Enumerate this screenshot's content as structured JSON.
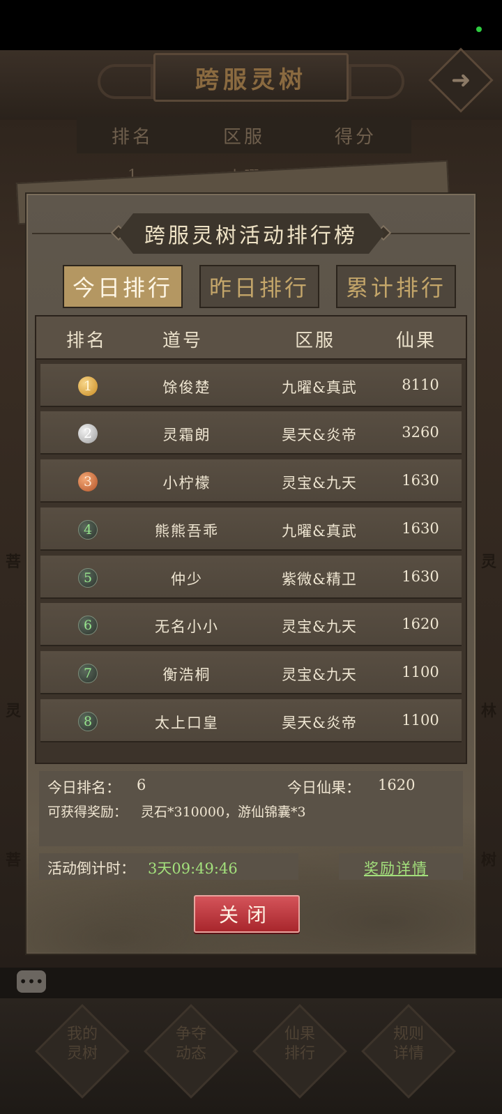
{
  "background": {
    "header_title": "跨服灵树",
    "table_headers": [
      "排名",
      "区服",
      "得分"
    ],
    "first_row": [
      "1",
      "九曜",
      ""
    ],
    "side_chars_left": [
      "菩",
      "灵",
      "菩"
    ],
    "side_chars_right": [
      "灵",
      "林",
      "树"
    ]
  },
  "modal": {
    "title": "跨服灵树活动排行榜",
    "tabs": [
      {
        "label": "今日排行",
        "active": true
      },
      {
        "label": "昨日排行",
        "active": false
      },
      {
        "label": "累计排行",
        "active": false
      }
    ],
    "columns": [
      "排名",
      "道号",
      "区服",
      "仙果"
    ],
    "rows": [
      {
        "rank": "1",
        "medal": "gold",
        "name": "馀俊楚",
        "server": "九曜&真武",
        "score": "8110"
      },
      {
        "rank": "2",
        "medal": "silver",
        "name": "灵霜朗",
        "server": "昊天&炎帝",
        "score": "3260"
      },
      {
        "rank": "3",
        "medal": "bronze",
        "name": "小柠檬",
        "server": "灵宝&九天",
        "score": "1630"
      },
      {
        "rank": "4",
        "medal": "green",
        "name": "熊熊吾乖",
        "server": "九曜&真武",
        "score": "1630"
      },
      {
        "rank": "5",
        "medal": "green",
        "name": "仲少",
        "server": "紫微&精卫",
        "score": "1630"
      },
      {
        "rank": "6",
        "medal": "green",
        "name": "无名小小",
        "server": "灵宝&九天",
        "score": "1620"
      },
      {
        "rank": "7",
        "medal": "green",
        "name": "衡浩桐",
        "server": "灵宝&九天",
        "score": "1100"
      },
      {
        "rank": "8",
        "medal": "green",
        "name": "太上口皇",
        "server": "昊天&炎帝",
        "score": "1100"
      }
    ],
    "my_rank_label": "今日排名：",
    "my_rank_value": "6",
    "my_score_label": "今日仙果：",
    "my_score_value": "1620",
    "reward_label": "可获得奖励：",
    "reward_value": "灵石*310000，游仙锦囊*3",
    "countdown_label": "活动倒计时：",
    "countdown_value": "3天09:49:46",
    "reward_detail_link": "奖励详情",
    "close_label": "关闭"
  },
  "bottom_nav": [
    {
      "line1": "我的",
      "line2": "灵树"
    },
    {
      "line1": "争夺",
      "line2": "动态"
    },
    {
      "line1": "仙果",
      "line2": "排行"
    },
    {
      "line1": "规则",
      "line2": "详情"
    }
  ],
  "icons": {
    "next": "arrow-right-icon",
    "chat": "chat-bubble-icon",
    "medal": "rank-medal-icon"
  },
  "colors": {
    "active_tab": "#b49762",
    "close_button": "#c23a40",
    "countdown": "#a3e07c"
  }
}
